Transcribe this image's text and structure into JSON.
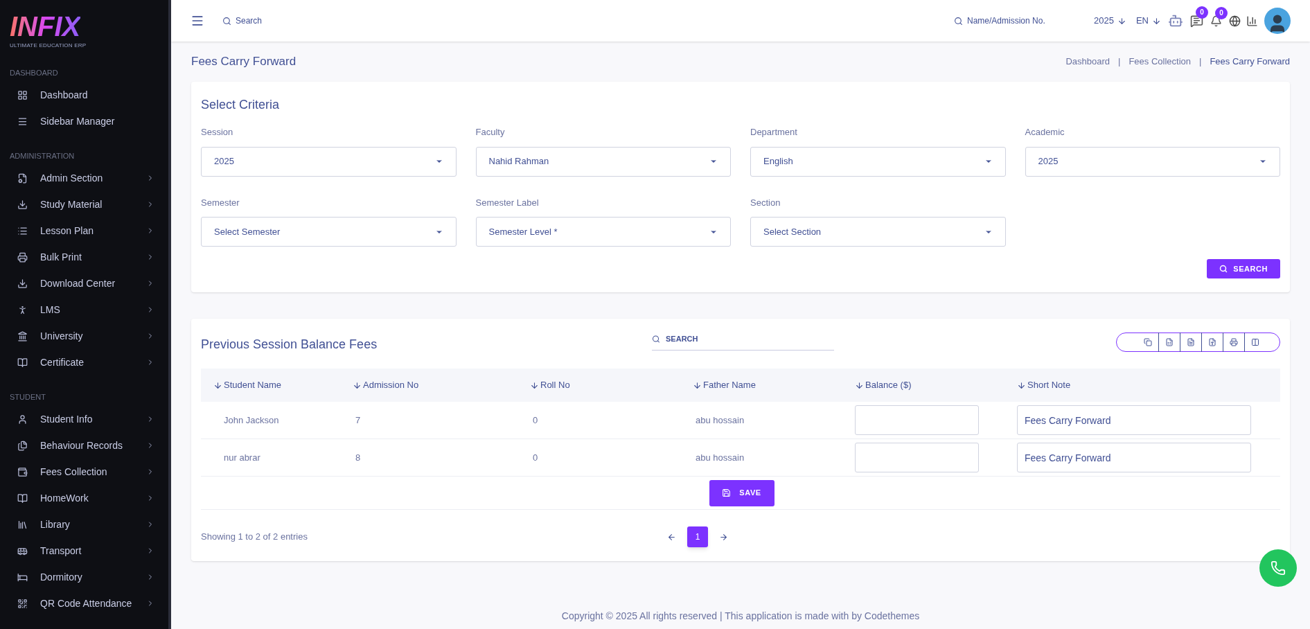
{
  "logo": {
    "title": "INFIX",
    "subtitle": "ULTIMATE EDUCATION ERP"
  },
  "sidebar": {
    "sections": [
      {
        "label": "DASHBOARD",
        "items": [
          {
            "label": "Dashboard",
            "expandable": false
          },
          {
            "label": "Sidebar Manager",
            "expandable": false
          }
        ]
      },
      {
        "label": "ADMINISTRATION",
        "items": [
          {
            "label": "Admin Section",
            "expandable": true
          },
          {
            "label": "Study Material",
            "expandable": true
          },
          {
            "label": "Lesson Plan",
            "expandable": true
          },
          {
            "label": "Bulk Print",
            "expandable": true
          },
          {
            "label": "Download Center",
            "expandable": true
          },
          {
            "label": "LMS",
            "expandable": true
          },
          {
            "label": "University",
            "expandable": true
          },
          {
            "label": "Certificate",
            "expandable": true
          }
        ]
      },
      {
        "label": "STUDENT",
        "items": [
          {
            "label": "Student Info",
            "expandable": true
          },
          {
            "label": "Behaviour Records",
            "expandable": true
          },
          {
            "label": "Fees Collection",
            "expandable": true
          },
          {
            "label": "HomeWork",
            "expandable": true
          },
          {
            "label": "Library",
            "expandable": true
          },
          {
            "label": "Transport",
            "expandable": true
          },
          {
            "label": "Dormitory",
            "expandable": true
          },
          {
            "label": "QR Code Attendance",
            "expandable": true
          }
        ]
      }
    ]
  },
  "header": {
    "search_placeholder": "Search",
    "student_search_placeholder": "Name/Admission No.",
    "year": "2025",
    "language": "EN",
    "messages_count": "0",
    "notifications_count": "0"
  },
  "page": {
    "title": "Fees Carry Forward",
    "breadcrumbs": [
      "Dashboard",
      "Fees Collection",
      "Fees Carry Forward"
    ],
    "breadcrumb_separator": "|"
  },
  "criteria": {
    "title": "Select Criteria",
    "fields": [
      {
        "label": "Session",
        "value": "2025"
      },
      {
        "label": "Faculty",
        "value": "Nahid Rahman"
      },
      {
        "label": "Department",
        "value": "English"
      },
      {
        "label": "Academic",
        "value": "2025"
      },
      {
        "label": "Semester",
        "value": "Select Semester"
      },
      {
        "label": "Semester Label",
        "value": "Semester Level *"
      },
      {
        "label": "Section",
        "value": "Select Section"
      }
    ],
    "search_button": "SEARCH"
  },
  "table": {
    "title": "Previous Session Balance Fees",
    "search_placeholder": "SEARCH",
    "columns": [
      "Student Name",
      "Admission No",
      "Roll No",
      "Father Name",
      "Balance ($)",
      "Short Note"
    ],
    "rows": [
      {
        "student_name": "John Jackson",
        "admission_no": "7",
        "roll_no": "0",
        "father_name": "abu hossain",
        "balance": "",
        "short_note": "Fees Carry Forward"
      },
      {
        "student_name": "nur abrar",
        "admission_no": "8",
        "roll_no": "0",
        "father_name": "abu hossain",
        "balance": "",
        "short_note": "Fees Carry Forward"
      }
    ],
    "save_button": "SAVE",
    "info": "Showing 1 to 2 of 2 entries",
    "pages": [
      {
        "label": "1",
        "selected": true
      }
    ]
  },
  "footer": "Copyright © 2025 All rights reserved | This application is made with by Codethemes"
}
